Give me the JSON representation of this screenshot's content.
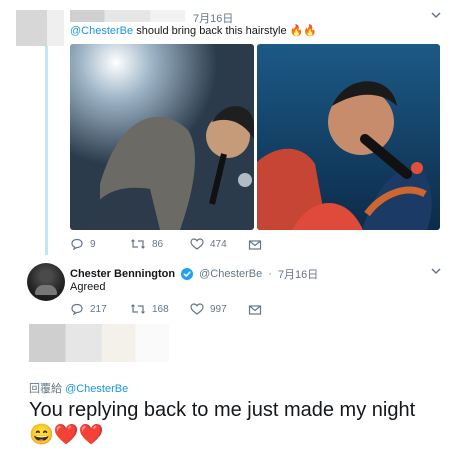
{
  "tweet1": {
    "date": "7月16日",
    "mention": "@ChesterBe",
    "text": "should bring back this hairstyle",
    "emoji": "🔥🔥",
    "actions": {
      "replies": "9",
      "retweets": "86",
      "likes": "474"
    }
  },
  "tweet2": {
    "name": "Chester Bennington",
    "handle": "@ChesterBe",
    "date": "7月16日",
    "text": "Agreed",
    "actions": {
      "replies": "217",
      "retweets": "168",
      "likes": "997"
    }
  },
  "tweet3": {
    "reply_to_prefix": "回覆給",
    "reply_to_handle": "@ChesterBe",
    "text": "You replying back to me just made my night",
    "emoji": "😄❤️❤️"
  },
  "colors": {
    "accent": "#1b95e0",
    "thread": "#c4e6f0",
    "muted": "#657786"
  }
}
